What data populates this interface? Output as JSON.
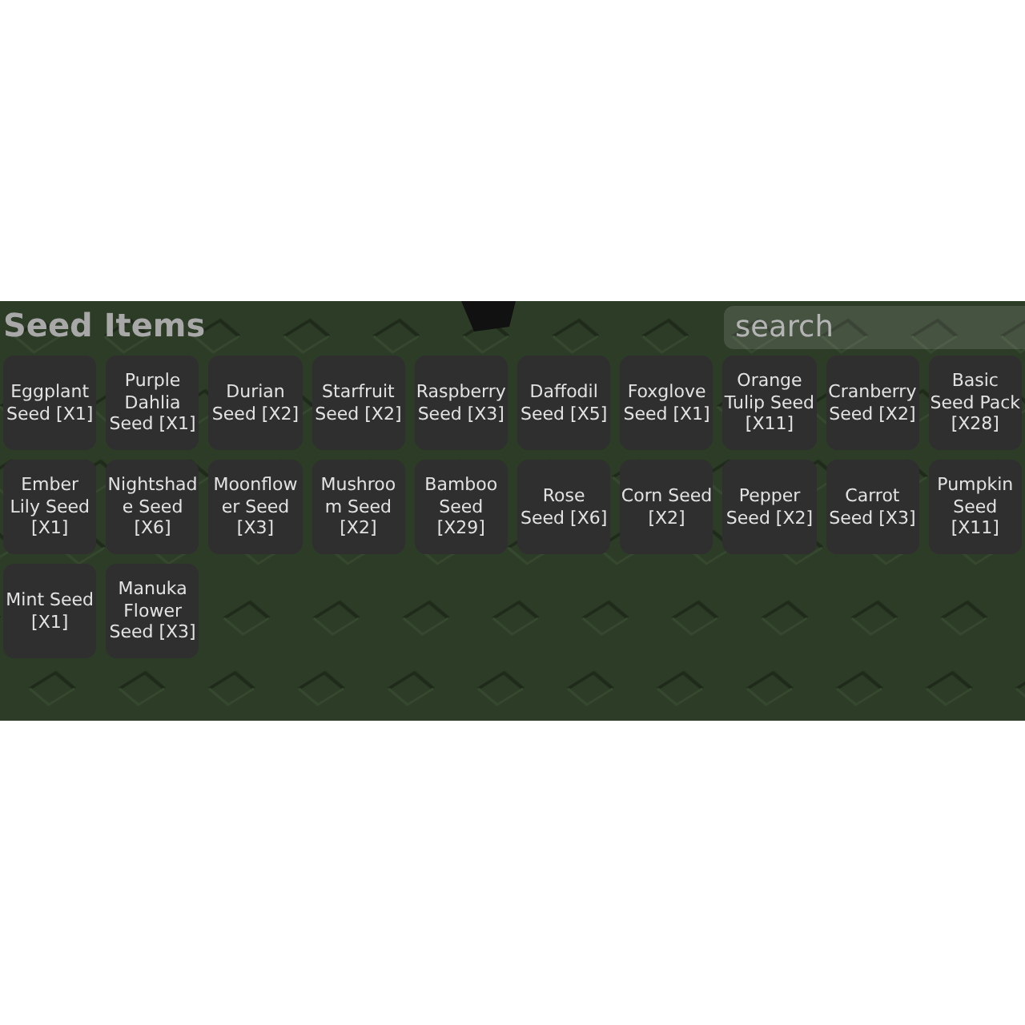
{
  "panel": {
    "title": "Seed Items",
    "search": {
      "placeholder": "search"
    },
    "items": [
      {
        "label": "Eggplant Seed [X1]"
      },
      {
        "label": "Purple Dahlia Seed [X1]"
      },
      {
        "label": "Durian Seed [X2]"
      },
      {
        "label": "Starfruit Seed [X2]"
      },
      {
        "label": "Raspberry Seed [X3]"
      },
      {
        "label": "Daffodil Seed [X5]"
      },
      {
        "label": "Foxglove Seed [X1]"
      },
      {
        "label": "Orange Tulip Seed [X11]"
      },
      {
        "label": "Cranberry Seed [X2]"
      },
      {
        "label": "Basic Seed Pack [X28]"
      },
      {
        "label": "Ember Lily Seed [X1]"
      },
      {
        "label": "Nightshade Seed [X6]"
      },
      {
        "label": "Moonflower Seed [X3]"
      },
      {
        "label": "Mushroom Seed [X2]"
      },
      {
        "label": "Bamboo Seed [X29]"
      },
      {
        "label": "Rose Seed [X6]"
      },
      {
        "label": "Corn Seed [X2]"
      },
      {
        "label": "Pepper Seed [X2]"
      },
      {
        "label": "Carrot Seed [X3]"
      },
      {
        "label": "Pumpkin Seed [X11]"
      },
      {
        "label": "Mint Seed [X1]"
      },
      {
        "label": "Manuka Flower Seed [X3]"
      }
    ]
  }
}
